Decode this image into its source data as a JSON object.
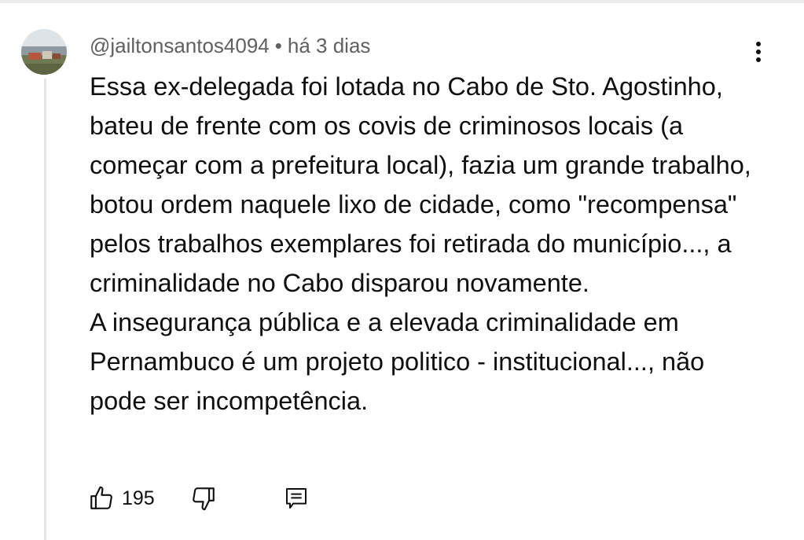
{
  "comment": {
    "author": "@jailtonsantos4094",
    "separator": "•",
    "timestamp": "há 3 dias",
    "paragraphs": [
      "Essa ex-delegada foi lotada no Cabo de Sto. Agostinho, bateu de frente com os covis de criminosos locais (a começar com a prefeitura local), fazia um grande trabalho, botou ordem naquele lixo de cidade, como \"recompensa\" pelos trabalhos exemplares foi retirada do município..., a criminalidade no Cabo disparou novamente.",
      "A insegurança pública e a elevada criminalidade em Pernambuco é um projeto politico - institucional..., não pode ser incompetência."
    ],
    "like_count": "195"
  },
  "icons": {
    "menu": "more-vert-icon",
    "like": "thumb-up-icon",
    "dislike": "thumb-down-icon",
    "reply": "comment-icon"
  },
  "colors": {
    "text": "#0f0f0f",
    "meta_text": "#606060",
    "thread_line": "#e5e5e5"
  }
}
